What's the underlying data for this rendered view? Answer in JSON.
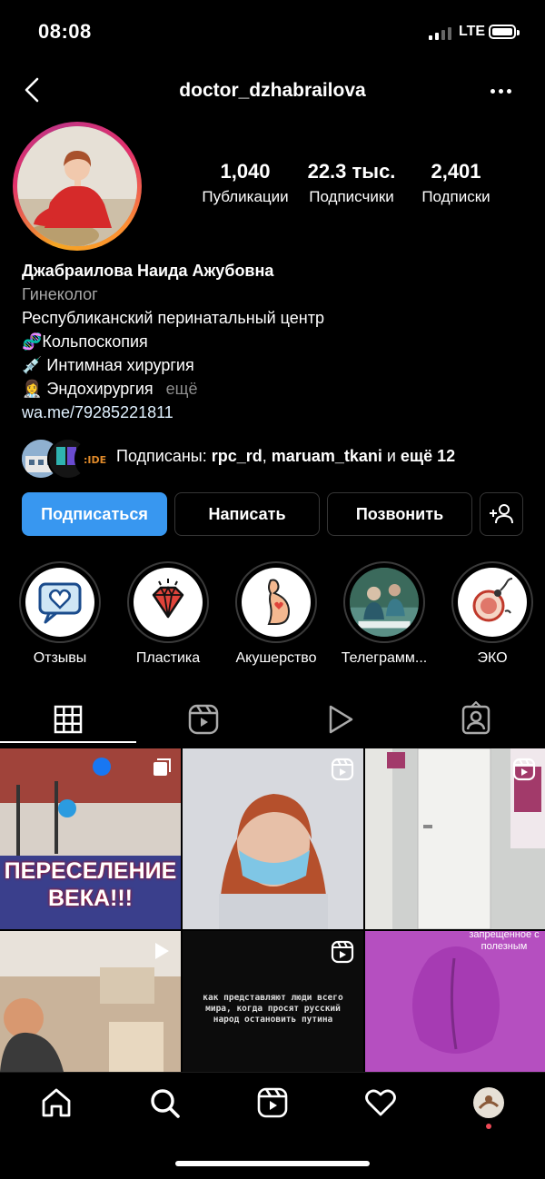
{
  "status": {
    "time": "08:08",
    "network": "LTE"
  },
  "header": {
    "username": "doctor_dzhabrailova"
  },
  "stats": [
    {
      "value": "1,040",
      "label": "Публикации"
    },
    {
      "value": "22.3 тыс.",
      "label": "Подписчики"
    },
    {
      "value": "2,401",
      "label": "Подписки"
    }
  ],
  "bio": {
    "name": "Джабраилова Наида Ажубовна",
    "category": "Гинеколог",
    "line1": "Республиканский перинатальный центр",
    "line2": "🧬Кольпоскопия",
    "line3": "💉 Интимная хирургия",
    "line4": "👩‍⚕️ Эндохирургия",
    "more": "ещё",
    "link": "wa.me/79285221811"
  },
  "followed_by": {
    "prefix": "Подписаны: ",
    "user1": "rpc_rd",
    "separator": ", ",
    "user2": "maruam_tkani",
    "suffix_and": " и ",
    "suffix_more": "ещё 12"
  },
  "buttons": {
    "follow": "Подписаться",
    "message": "Написать",
    "call": "Позвонить"
  },
  "highlights": [
    {
      "label": "Отзывы",
      "icon": "heart-chat-icon"
    },
    {
      "label": "Пластика",
      "icon": "diamond-icon"
    },
    {
      "label": "Акушерство",
      "icon": "pregnancy-icon"
    },
    {
      "label": "Телеграмм...",
      "icon": "surgery-photo"
    },
    {
      "label": "ЭКО",
      "icon": "egg-sperm-icon"
    }
  ],
  "posts": {
    "post1_text": "ПЕРЕСЕЛЕНИЕ ВЕКА!!!",
    "post1_line1": "ПЕРЕСЕЛЕНИЕ",
    "post1_line2": "ВЕКА!!!",
    "post5_text": "как представляют люди всего мира, когда просят русский народ остановить путина",
    "post6_text": "запрещенное с полезным"
  },
  "colors": {
    "accent": "#3897f0",
    "background": "#000000"
  }
}
